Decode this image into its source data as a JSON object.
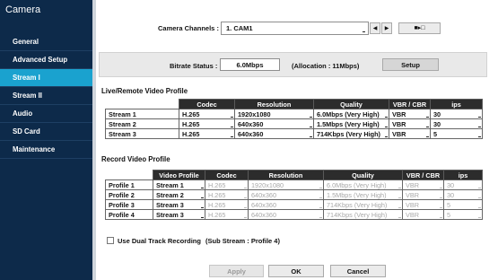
{
  "sidebar": {
    "title": "Camera",
    "items": [
      {
        "label": "General"
      },
      {
        "label": "Advanced Setup"
      },
      {
        "label": "Stream I"
      },
      {
        "label": "Stream II"
      },
      {
        "label": "Audio"
      },
      {
        "label": "SD Card"
      },
      {
        "label": "Maintenance"
      }
    ],
    "active_item": "Stream I",
    "active_color": "#1aa2cf",
    "background_color": "#0d2a4a"
  },
  "channels": {
    "label": "Camera Channels :",
    "value": "1. CAM1",
    "prev_icon": "triangle-left",
    "next_icon": "triangle-right",
    "copy_icon": "copy-settings"
  },
  "bitrate": {
    "label": "Bitrate Status :",
    "value": "6.0Mbps",
    "allocation": "(Allocation : 11Mbps)",
    "setup_label": "Setup"
  },
  "live": {
    "section_title": "Live/Remote Video Profile",
    "headers": [
      "Codec",
      "Resolution",
      "Quality",
      "VBR / CBR",
      "ips"
    ],
    "rows": [
      {
        "name": "Stream 1",
        "codec": "H.265",
        "resolution": "1920x1080",
        "quality": "6.0Mbps (Very High)",
        "vbr": "VBR",
        "ips": "30"
      },
      {
        "name": "Stream 2",
        "codec": "H.265",
        "resolution": "640x360",
        "quality": "1.5Mbps (Very High)",
        "vbr": "VBR",
        "ips": "30"
      },
      {
        "name": "Stream 3",
        "codec": "H.265",
        "resolution": "640x360",
        "quality": "714Kbps (Very High)",
        "vbr": "VBR",
        "ips": "5"
      }
    ]
  },
  "record": {
    "section_title": "Record Video Profile",
    "headers": [
      "Video Profile",
      "Codec",
      "Resolution",
      "Quality",
      "VBR / CBR",
      "ips"
    ],
    "rows": [
      {
        "name": "Profile 1",
        "profile": "Stream 1",
        "codec": "H.265",
        "resolution": "1920x1080",
        "quality": "6.0Mbps (Very High)",
        "vbr": "VBR",
        "ips": "30"
      },
      {
        "name": "Profile 2",
        "profile": "Stream 2",
        "codec": "H.265",
        "resolution": "640x360",
        "quality": "1.5Mbps (Very High)",
        "vbr": "VBR",
        "ips": "30"
      },
      {
        "name": "Profile 3",
        "profile": "Stream 3",
        "codec": "H.265",
        "resolution": "640x360",
        "quality": "714Kbps (Very High)",
        "vbr": "VBR",
        "ips": "5"
      },
      {
        "name": "Profile 4",
        "profile": "Stream 3",
        "codec": "H.265",
        "resolution": "640x360",
        "quality": "714Kbps (Very High)",
        "vbr": "VBR",
        "ips": "5"
      }
    ]
  },
  "dual_track": {
    "label": "Use Dual Track Recording",
    "note": "(Sub Stream : Profile 4)",
    "checked": false
  },
  "footer": {
    "apply_label": "Apply",
    "ok_label": "OK",
    "cancel_label": "Cancel"
  }
}
